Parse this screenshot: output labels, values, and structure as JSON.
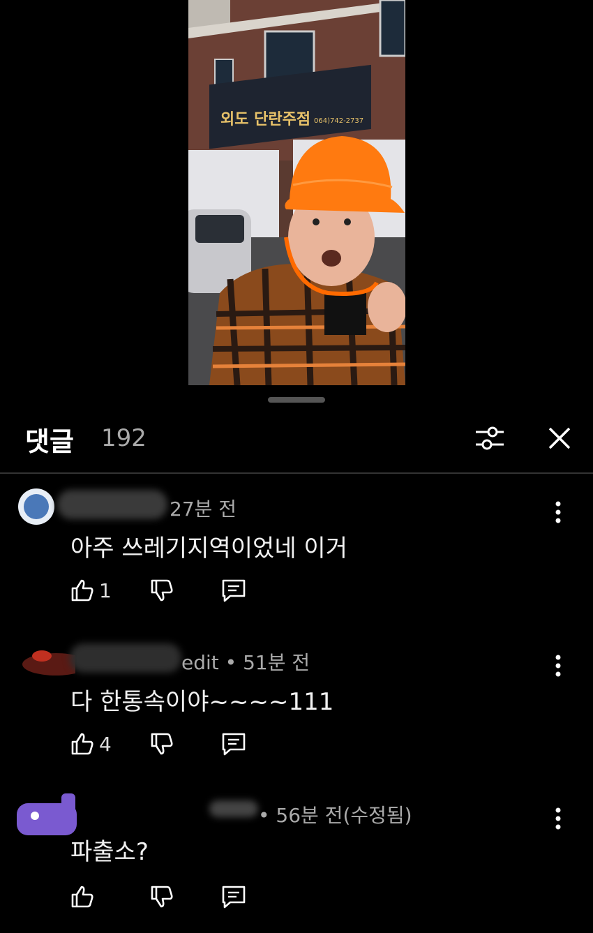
{
  "header": {
    "title": "댓글",
    "count": "192"
  },
  "comments": [
    {
      "author": "",
      "time": "27분 전",
      "text": "아주 쓰레기지역이었네 이거",
      "likes": "1"
    },
    {
      "author": "edit",
      "time": "51분 전",
      "text": "다 한통속이야~~~~111",
      "likes": "4"
    },
    {
      "author": "",
      "time": "56분 전(수정됨)",
      "text": "파출소?",
      "likes": ""
    }
  ],
  "video": {
    "sign_text": "외도 단란주점",
    "sign_phone": "064)742-2737"
  },
  "colors": {
    "background": "#000000",
    "accent_hat": "#ff7a10",
    "divider": "#333333"
  },
  "icons": [
    "filter-icon",
    "close-icon",
    "more-icon",
    "like-icon",
    "dislike-icon",
    "reply-icon"
  ]
}
